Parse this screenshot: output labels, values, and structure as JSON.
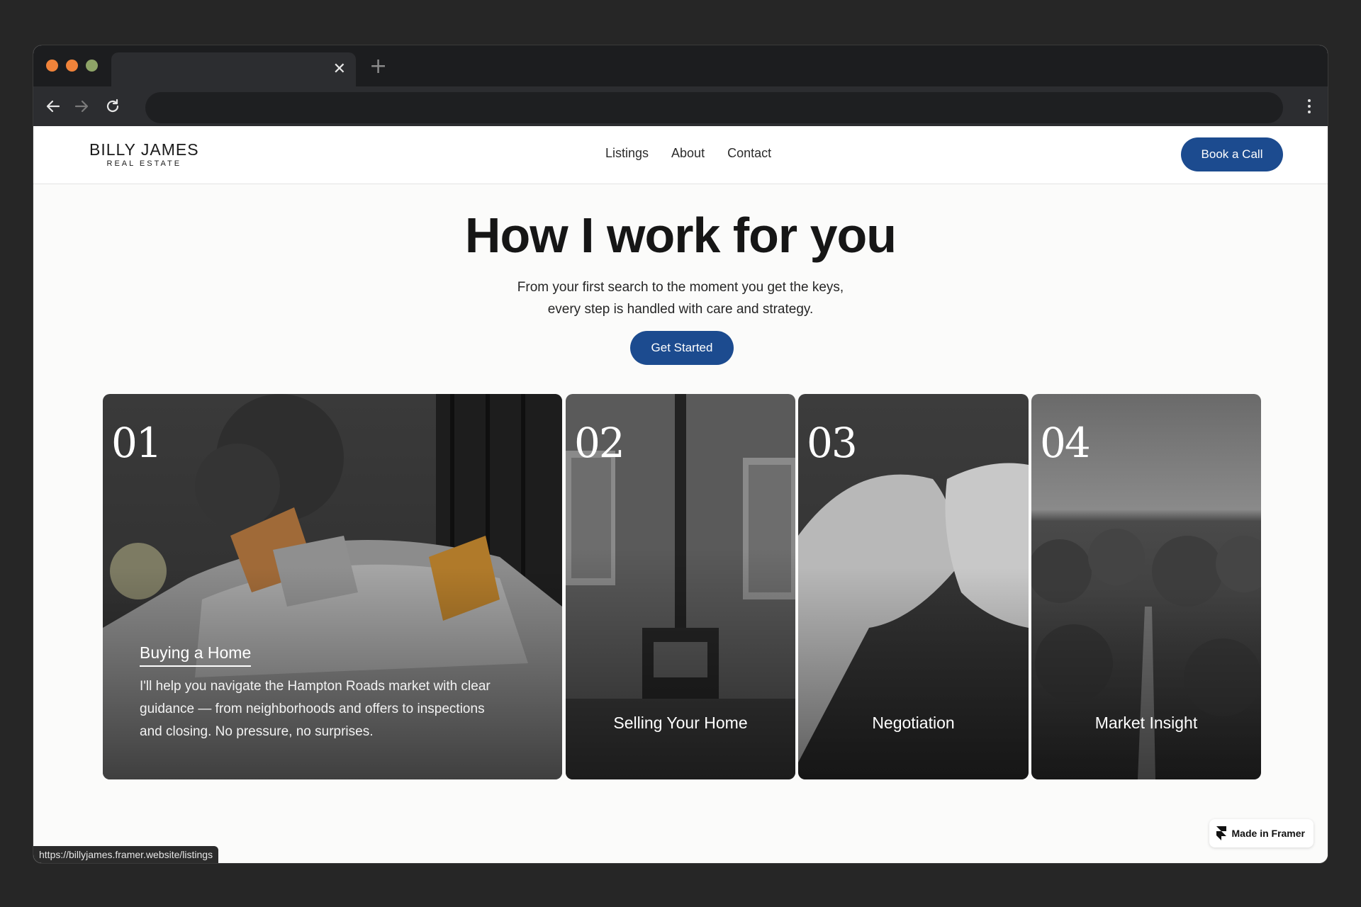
{
  "browser": {
    "dot_colors": [
      "#f0833a",
      "#f0833a",
      "#8ea467"
    ],
    "tab_close": "✕",
    "new_tab": "+"
  },
  "site": {
    "logo_main": "BILLY JAMES",
    "logo_sub": "REAL ESTATE",
    "nav": [
      "Listings",
      "About",
      "Contact"
    ],
    "book_label": "Book a Call",
    "accent": "#1c4b8f"
  },
  "hero": {
    "title": "How I work for you",
    "subtitle_line1": "From your first search to the moment you get the keys,",
    "subtitle_line2": "every step is handled with care and strategy.",
    "cta": "Get Started"
  },
  "cards": [
    {
      "number": "01",
      "title": "Buying a Home",
      "description": "I'll help you navigate the Hampton Roads market with clear guidance — from neighborhoods and offers to inspections and closing. No pressure, no surprises."
    },
    {
      "number": "02",
      "title": "Selling Your Home"
    },
    {
      "number": "03",
      "title": "Negotiation"
    },
    {
      "number": "04",
      "title": "Market Insight"
    }
  ],
  "status_url": "https://billyjames.framer.website/listings",
  "framer_badge": "Made in Framer"
}
